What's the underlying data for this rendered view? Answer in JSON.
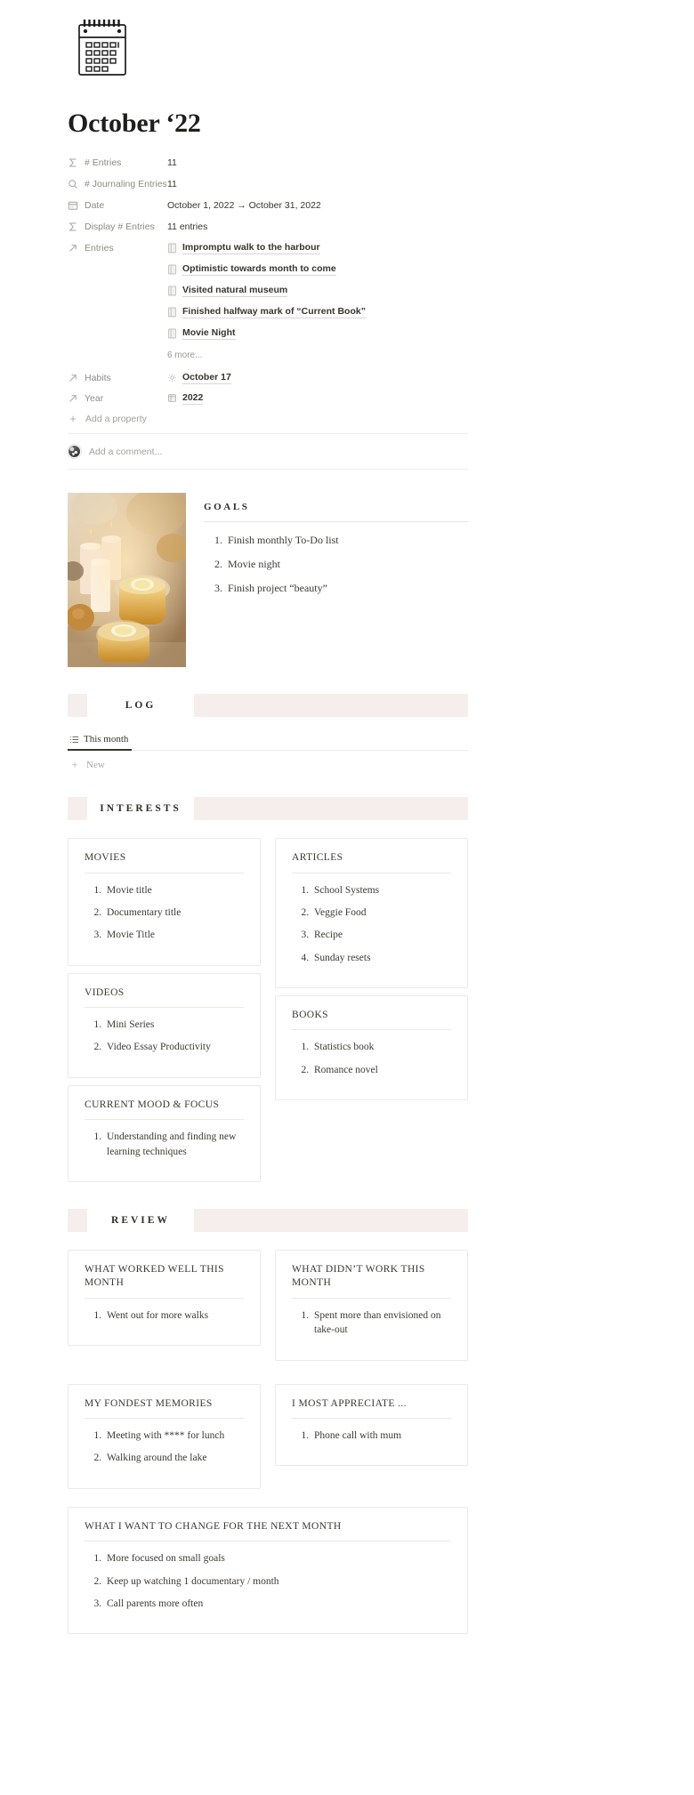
{
  "page": {
    "icon_name": "calendar-icon",
    "title": "October ‘22"
  },
  "properties": [
    {
      "icon": "sigma-icon",
      "label": "# Entries",
      "value": "11"
    },
    {
      "icon": "search-icon",
      "label": "# Journaling Entries",
      "value": "11"
    },
    {
      "icon": "calendar-icon",
      "label": "Date",
      "value": "October 1, 2022 → October 31, 2022"
    },
    {
      "icon": "sigma-icon",
      "label": "Display # Entries",
      "value": "11 entries"
    }
  ],
  "entries_property": {
    "icon": "relation-arrow-icon",
    "label": "Entries",
    "items": [
      "Impromptu walk to the harbour",
      "Optimistic towards month to come",
      "Visited natural museum",
      "Finished halfway mark of “Current Book”",
      "Movie Night"
    ],
    "more_label": "6 more..."
  },
  "relation_properties": [
    {
      "icon": "relation-arrow-icon",
      "label": "Habits",
      "value_icon": "gear-icon",
      "value": "October 17"
    },
    {
      "icon": "relation-arrow-icon",
      "label": "Year",
      "value_icon": "calendar-page-icon",
      "value": "2022"
    }
  ],
  "add_property": {
    "icon": "plus-icon",
    "label": "Add a property"
  },
  "comment": {
    "avatar": "user-avatar",
    "placeholder": "Add a comment..."
  },
  "goals": {
    "photo_alt": "autumn-candles-tea-photo",
    "title": "GOALS",
    "items": [
      "Finish monthly To-Do list",
      "Movie night",
      "Finish project “beauty”"
    ]
  },
  "log": {
    "banner_label": "LOG",
    "tab": {
      "icon": "list-view-icon",
      "label": "This month"
    },
    "new_button": {
      "icon": "plus-icon",
      "label": "New"
    }
  },
  "interests": {
    "banner_label": "INTERESTS",
    "left_cards": [
      {
        "title": "MOVIES",
        "items": [
          "Movie title",
          "Documentary title",
          "Movie Title"
        ]
      },
      {
        "title": "VIDEOS",
        "items": [
          "Mini Series",
          "Video Essay Productivity"
        ]
      },
      {
        "title": "CURRENT MOOD & FOCUS",
        "items": [
          "Understanding and finding new learning techniques"
        ]
      }
    ],
    "right_cards": [
      {
        "title": "ARTICLES",
        "items": [
          "School Systems",
          "Veggie Food",
          "Recipe",
          "Sunday resets"
        ]
      },
      {
        "title": "BOOKS",
        "items": [
          "Statistics book",
          "Romance novel"
        ]
      }
    ]
  },
  "review": {
    "banner_label": "REVIEW",
    "left_cards": [
      {
        "title": "WHAT WORKED WELL THIS MONTH",
        "items": [
          "Went out for more walks"
        ]
      },
      {
        "title": "MY FONDEST MEMORIES",
        "items": [
          "Meeting with **** for lunch",
          "Walking around the lake"
        ]
      }
    ],
    "right_cards": [
      {
        "title": "WHAT DIDN’T WORK THIS MONTH",
        "items": [
          "Spent more than envisioned on take-out"
        ]
      },
      {
        "title": "I MOST APPRECIATE ...",
        "items": [
          "Phone call with mum"
        ]
      }
    ],
    "wide_card": {
      "title": "WHAT I WANT TO CHANGE FOR THE NEXT MONTH",
      "items": [
        "More focused on small goals",
        "Keep up watching 1 documentary / month",
        "Call parents more often"
      ]
    }
  },
  "colors": {
    "banner": "#f6eeec",
    "text": "#37352f",
    "muted": "#8d8b86",
    "border": "#eceae7"
  }
}
